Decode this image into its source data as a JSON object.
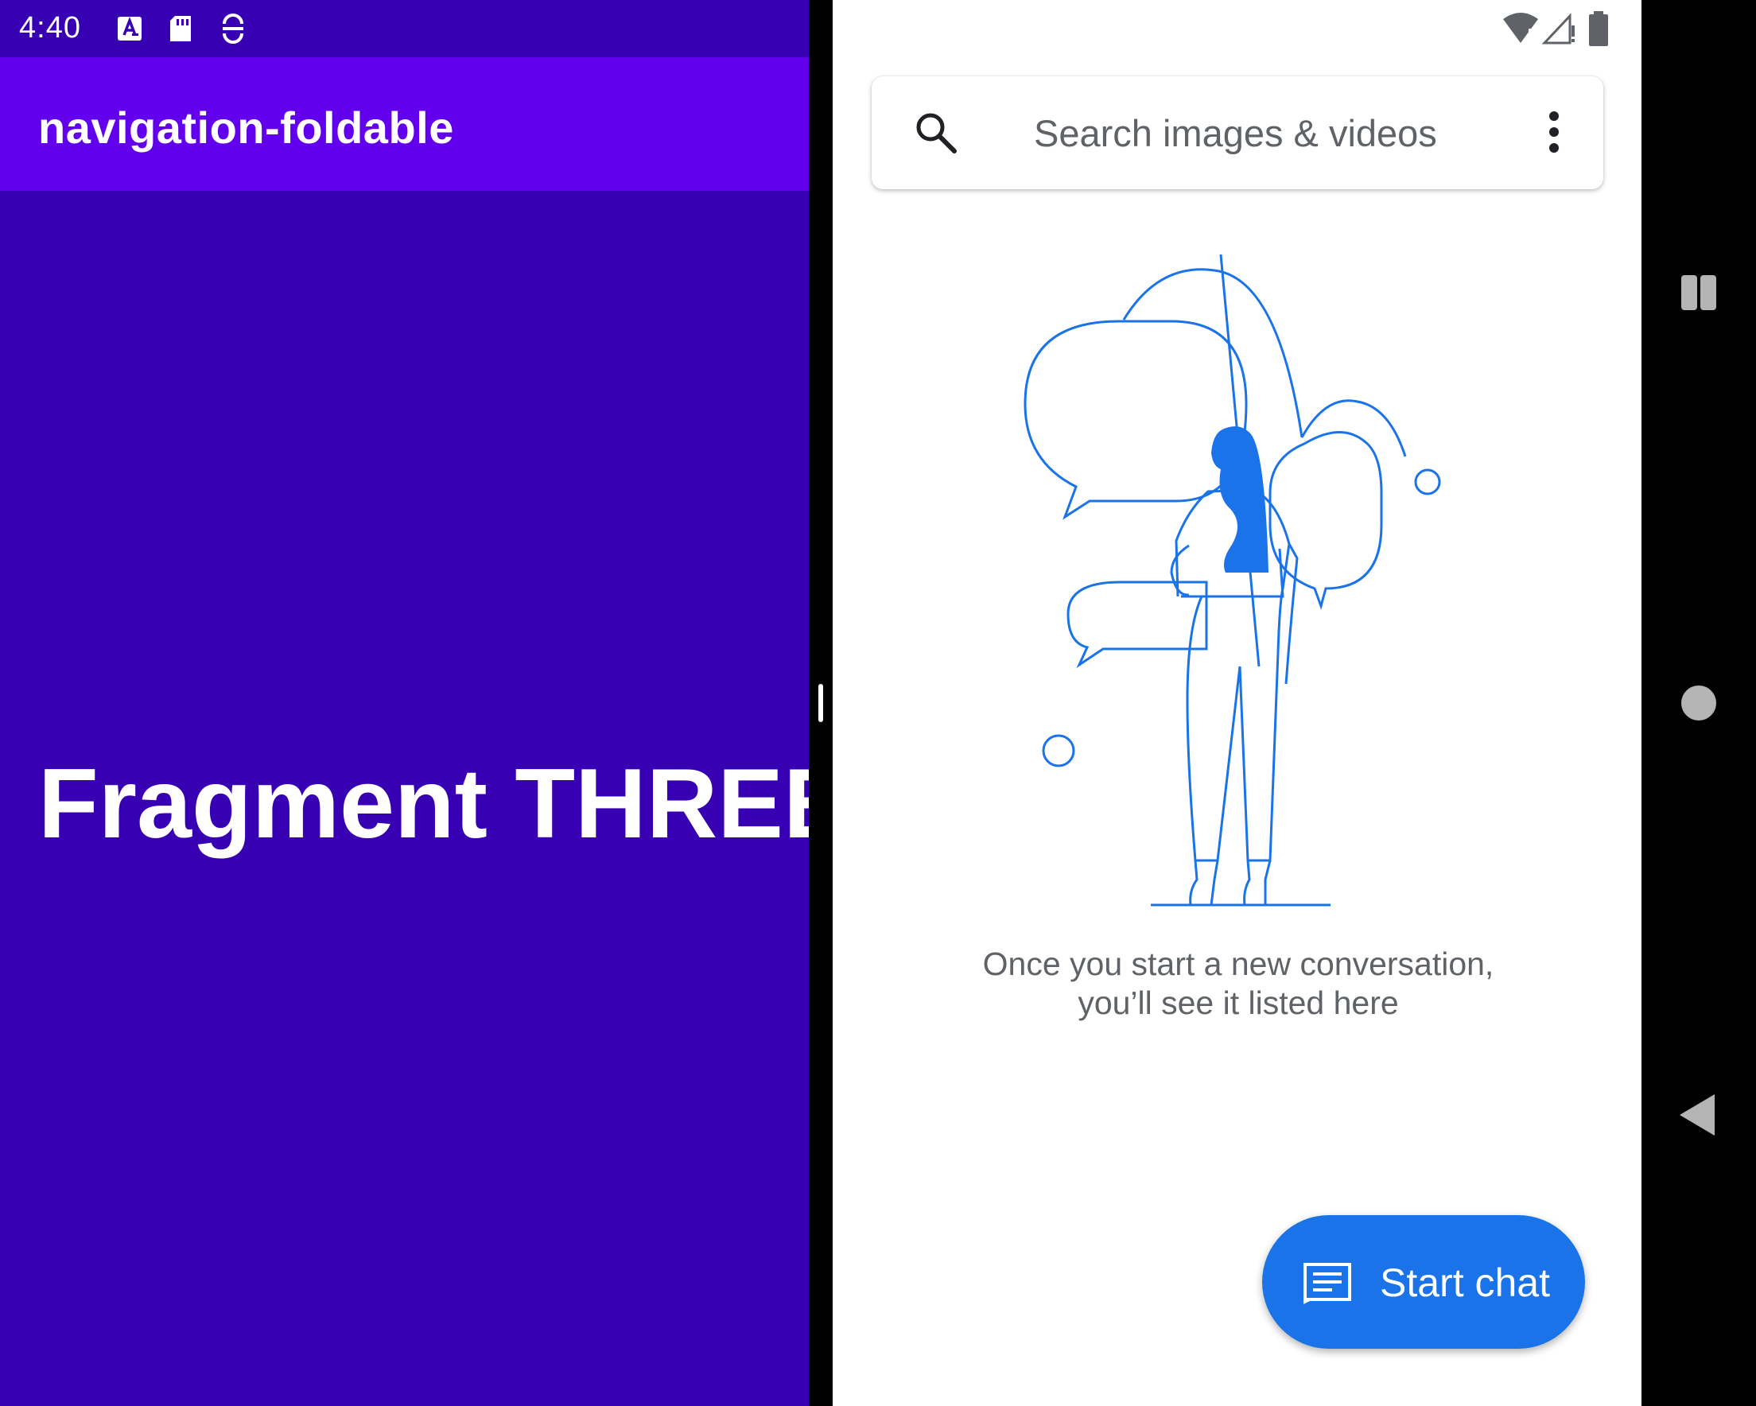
{
  "status_bar": {
    "time": "4:40",
    "left_icons": [
      "text-a-icon",
      "sd-card-icon",
      "assistant-icon"
    ],
    "right_icons": [
      "wifi-icon",
      "signal-icon",
      "battery-icon"
    ]
  },
  "left_app": {
    "title": "navigation-foldable",
    "fragment_label": "Fragment THREE",
    "colors": {
      "app_bar": "#6200ee",
      "background": "#3700b3"
    }
  },
  "right_app": {
    "search": {
      "placeholder": "Search images & videos",
      "icon": "search-icon",
      "menu_icon": "more-vert-icon"
    },
    "empty_state": {
      "illustration": "woman-with-speech-bubbles-illustration",
      "message": "Once you start a new conversation, you’ll see it listed here"
    },
    "fab": {
      "label": "Start chat",
      "icon": "message-icon"
    },
    "colors": {
      "accent": "#1a73e8",
      "text_secondary": "#5f6368"
    }
  },
  "nav_bar": {
    "buttons": [
      "recents-icon",
      "home-icon",
      "back-icon"
    ]
  }
}
